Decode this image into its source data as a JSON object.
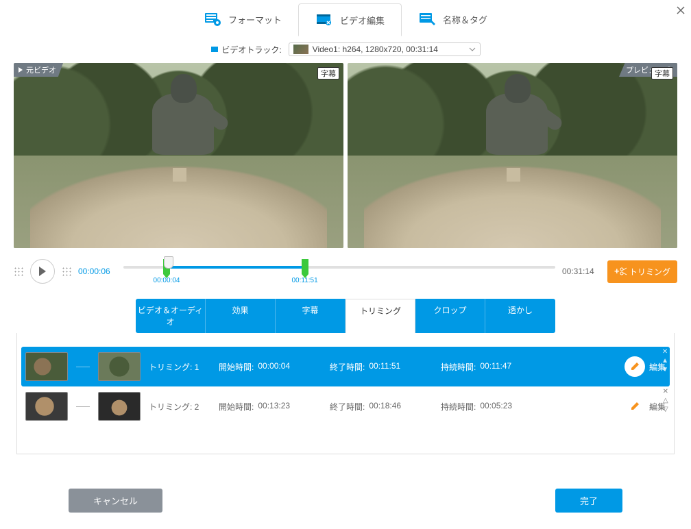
{
  "window": {
    "close_title": "Close"
  },
  "top_tabs": {
    "format": "フォーマット",
    "video_edit": "ビデオ編集",
    "name_tag": "名称＆タグ"
  },
  "track": {
    "label": "ビデオトラック:",
    "value": "Video1: h264, 1280x720, 00:31:14"
  },
  "preview": {
    "source_label": "元ビデオ",
    "preview_label": "プレビュー",
    "subtitle_badge": "字幕"
  },
  "timeline": {
    "current": "00:00:06",
    "duration": "00:31:14",
    "mark_start": "00:00:04",
    "mark_end": "00:11:51",
    "sel_start_pct": 10,
    "sel_end_pct": 42,
    "pointer_pct": 10.5,
    "trim_button": "トリミング"
  },
  "edit_tabs": {
    "video_audio": "ビデオ＆オーディオ",
    "effect": "効果",
    "subtitle": "字幕",
    "trimming": "トリミング",
    "crop": "クロップ",
    "watermark": "透かし"
  },
  "trim_list": {
    "label_prefix": "トリミング:",
    "start_label": "開始時間:",
    "end_label": "終了時間:",
    "duration_label": "持続時間:",
    "edit_label": "編集",
    "items": [
      {
        "index": "1",
        "start": "00:00:04",
        "end": "00:11:51",
        "duration": "00:11:47",
        "selected": true
      },
      {
        "index": "2",
        "start": "00:13:23",
        "end": "00:18:46",
        "duration": "00:05:23",
        "selected": false
      }
    ]
  },
  "buttons": {
    "cancel": "キャンセル",
    "done": "完了"
  }
}
